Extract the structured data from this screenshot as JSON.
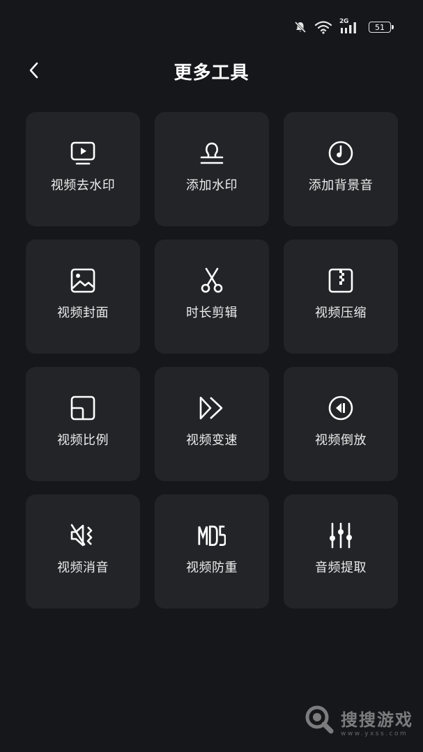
{
  "status_bar": {
    "network_label": "2G",
    "battery_level": "51",
    "icons": [
      "bell-muted-icon",
      "wifi-icon",
      "cellular-signal-icon",
      "battery-icon"
    ]
  },
  "header": {
    "back_icon": "chevron-left-icon",
    "title": "更多工具"
  },
  "tools": [
    {
      "label": "视频去水印",
      "icon": "video-play-screen-icon"
    },
    {
      "label": "添加水印",
      "icon": "stamp-icon"
    },
    {
      "label": "添加背景音",
      "icon": "music-disc-icon"
    },
    {
      "label": "视频封面",
      "icon": "image-icon"
    },
    {
      "label": "时长剪辑",
      "icon": "scissors-icon"
    },
    {
      "label": "视频压缩",
      "icon": "zip-file-icon"
    },
    {
      "label": "视频比例",
      "icon": "aspect-ratio-icon"
    },
    {
      "label": "视频变速",
      "icon": "fast-forward-icon"
    },
    {
      "label": "视频倒放",
      "icon": "reverse-play-icon"
    },
    {
      "label": "视频消音",
      "icon": "speaker-mute-icon"
    },
    {
      "label": "视频防重",
      "icon": "md5-icon",
      "icon_text": "MD5"
    },
    {
      "label": "音频提取",
      "icon": "equalizer-sliders-icon"
    }
  ],
  "watermark": {
    "title": "搜搜游戏",
    "url": "www.yxss.com"
  },
  "colors": {
    "background": "#16171b",
    "card": "#232428",
    "text": "#ffffff"
  }
}
